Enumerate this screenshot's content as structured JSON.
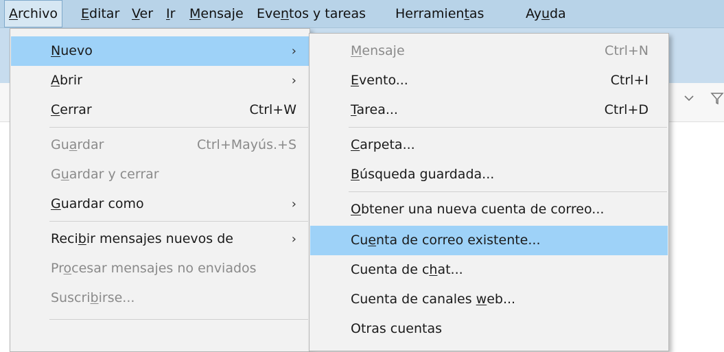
{
  "menubar": {
    "items": [
      {
        "pre": "",
        "u": "A",
        "post": "rchivo"
      },
      {
        "pre": "",
        "u": "E",
        "post": "ditar"
      },
      {
        "pre": "",
        "u": "V",
        "post": "er"
      },
      {
        "pre": "",
        "u": "I",
        "post": "r"
      },
      {
        "pre": "",
        "u": "M",
        "post": "ensaje"
      },
      {
        "pre": "Eve",
        "u": "n",
        "post": "tos y tareas"
      },
      {
        "pre": "Herramien",
        "u": "t",
        "post": "as"
      },
      {
        "pre": "Ay",
        "u": "u",
        "post": "da"
      }
    ]
  },
  "archivo_menu": {
    "items": [
      {
        "pre": "",
        "u": "N",
        "post": "uevo",
        "shortcut": "",
        "submenu": true,
        "disabled": false,
        "highlighted": true
      },
      {
        "pre": "",
        "u": "A",
        "post": "brir",
        "shortcut": "",
        "submenu": true,
        "disabled": false,
        "highlighted": false
      },
      {
        "pre": "",
        "u": "C",
        "post": "errar",
        "shortcut": "Ctrl+W",
        "submenu": false,
        "disabled": false,
        "highlighted": false
      },
      {
        "pre": "Gu",
        "u": "a",
        "post": "rdar",
        "shortcut": "Ctrl+Mayús.+S",
        "submenu": false,
        "disabled": true,
        "highlighted": false
      },
      {
        "pre": "G",
        "u": "u",
        "post": "ardar y cerrar",
        "shortcut": "",
        "submenu": false,
        "disabled": true,
        "highlighted": false
      },
      {
        "pre": "",
        "u": "G",
        "post": "uardar como",
        "shortcut": "",
        "submenu": true,
        "disabled": false,
        "highlighted": false
      },
      {
        "pre": "Reci",
        "u": "b",
        "post": "ir mensajes nuevos de",
        "shortcut": "",
        "submenu": true,
        "disabled": false,
        "highlighted": false
      },
      {
        "pre": "Pr",
        "u": "o",
        "post": "cesar mensajes no enviados",
        "shortcut": "",
        "submenu": false,
        "disabled": true,
        "highlighted": false
      },
      {
        "pre": "Suscri",
        "u": "b",
        "post": "irse...",
        "shortcut": "",
        "submenu": false,
        "disabled": true,
        "highlighted": false
      }
    ]
  },
  "nuevo_submenu": {
    "items": [
      {
        "pre": "",
        "u": "M",
        "post": "ensaje",
        "shortcut": "Ctrl+N",
        "disabled": true,
        "highlighted": false
      },
      {
        "pre": "",
        "u": "E",
        "post": "vento...",
        "shortcut": "Ctrl+I",
        "disabled": false,
        "highlighted": false
      },
      {
        "pre": "",
        "u": "T",
        "post": "area...",
        "shortcut": "Ctrl+D",
        "disabled": false,
        "highlighted": false
      },
      {
        "pre": "",
        "u": "C",
        "post": "arpeta...",
        "shortcut": "",
        "disabled": false,
        "highlighted": false
      },
      {
        "pre": "",
        "u": "B",
        "post": "úsqueda guardada...",
        "shortcut": "",
        "disabled": false,
        "highlighted": false
      },
      {
        "pre": "",
        "u": "O",
        "post": "btener una nueva cuenta de correo...",
        "shortcut": "",
        "disabled": false,
        "highlighted": false
      },
      {
        "pre": "Cu",
        "u": "e",
        "post": "nta de correo existente...",
        "shortcut": "",
        "disabled": false,
        "highlighted": true
      },
      {
        "pre": "Cuenta de c",
        "u": "h",
        "post": "at...",
        "shortcut": "",
        "disabled": false,
        "highlighted": false
      },
      {
        "pre": "Cuenta de canales ",
        "u": "w",
        "post": "eb...",
        "shortcut": "",
        "disabled": false,
        "highlighted": false
      },
      {
        "pre": "Otras cuentas",
        "u": "",
        "post": "",
        "shortcut": "",
        "disabled": false,
        "highlighted": false
      }
    ]
  },
  "colors": {
    "menubar_bg": "#b8d3e8",
    "menu_bg": "#f2f2f2",
    "highlight": "#9ed2f8",
    "disabled_text": "#8a8a8a"
  },
  "icons": {
    "submenu_arrow": "chevron-right-icon",
    "toolbar_dropdown": "chevron-down-icon",
    "toolbar_filter": "filter-icon"
  }
}
